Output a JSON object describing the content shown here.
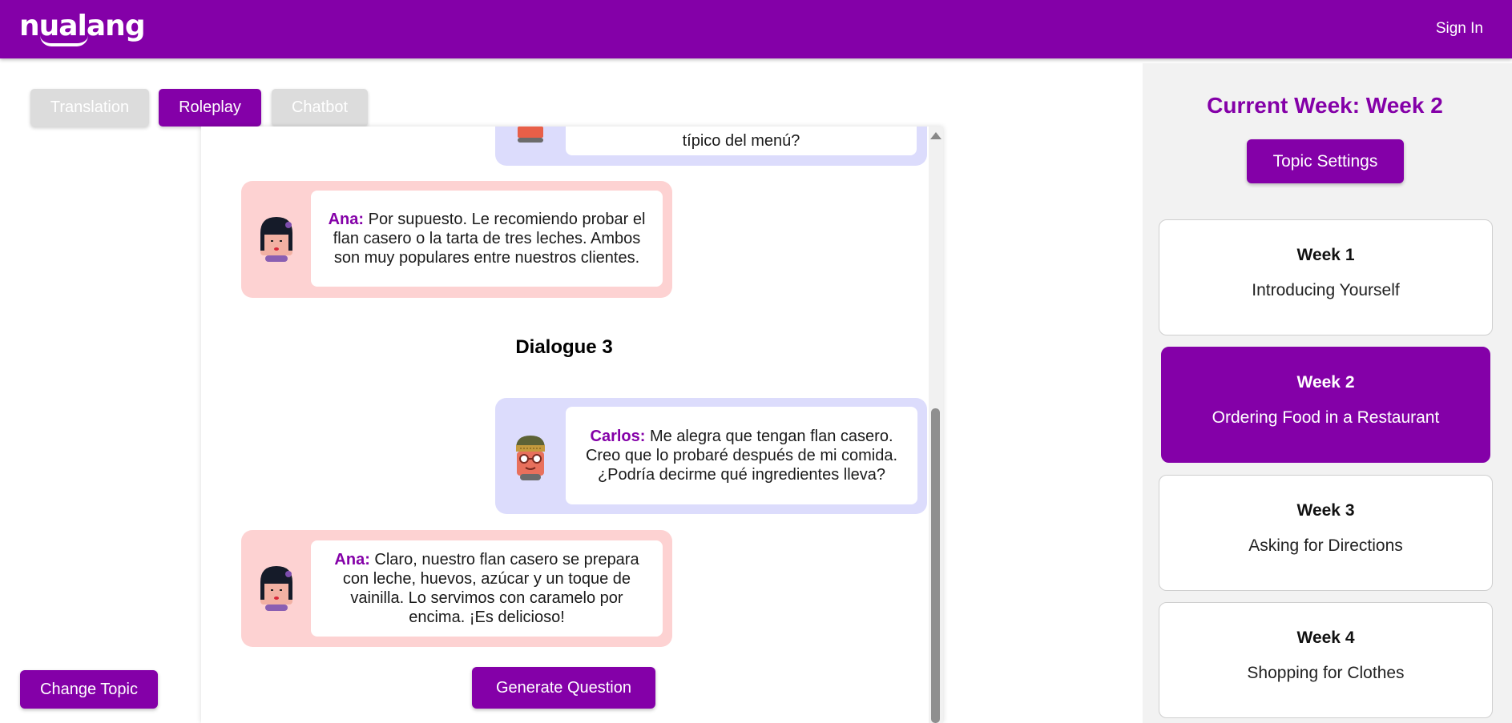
{
  "header": {
    "logo": "nualang",
    "sign_in": "Sign In"
  },
  "tabs": [
    {
      "label": "Translation",
      "active": false
    },
    {
      "label": "Roleplay",
      "active": true
    },
    {
      "label": "Chatbot",
      "active": false
    }
  ],
  "chat": {
    "messages": [
      {
        "speaker": "",
        "text": "típico del menú?",
        "side": "right"
      },
      {
        "speaker": "Ana:",
        "text": " Por supuesto. Le recomiendo probar el flan casero o la tarta de tres leches. Ambos son muy populares entre nuestros clientes.",
        "side": "left"
      },
      {
        "speaker": "Carlos:",
        "text": " Me alegra que tengan flan casero. Creo que lo probaré después de mi comida. ¿Podría decirme qué ingredientes lleva?",
        "side": "right"
      },
      {
        "speaker": "Ana:",
        "text": " Claro, nuestro flan casero se prepara con leche, huevos, azúcar y un toque de vainilla. Lo servimos con caramelo por encima. ¡Es delicioso!",
        "side": "left"
      }
    ],
    "dialogue_heading": "Dialogue 3",
    "generate_question": "Generate Question"
  },
  "change_topic": "Change Topic",
  "sidebar": {
    "current_week": "Current Week: Week 2",
    "topic_settings": "Topic Settings",
    "weeks": [
      {
        "title": "Week 1",
        "topic": "Introducing Yourself",
        "active": false
      },
      {
        "title": "Week 2",
        "topic": "Ordering Food in a Restaurant",
        "active": true
      },
      {
        "title": "Week 3",
        "topic": "Asking for Directions",
        "active": false
      },
      {
        "title": "Week 4",
        "topic": "Shopping for Clothes",
        "active": false
      }
    ]
  },
  "colors": {
    "brand": "#8400a8",
    "carlos_bubble": "#dcdcfc",
    "ana_bubble": "#fdd2d2",
    "sidebar_bg": "#f2f2f2"
  }
}
